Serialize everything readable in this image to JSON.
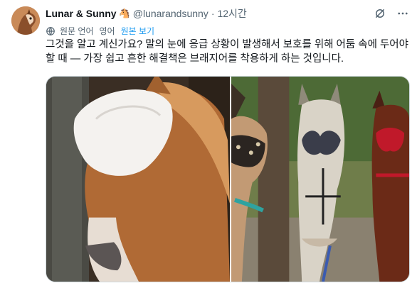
{
  "tweet": {
    "display_name": "Lunar & Sunny",
    "name_emoji": "🐴",
    "handle": "@lunarandsunny",
    "separator": "·",
    "time": "12시간",
    "translation": {
      "original_language": "원문 언어",
      "language": "영어",
      "show_original": "원본 보기"
    },
    "text": "그것을 알고 계신가요? 말의 눈에 응급 상황이 발생해서 보호를 위해 어둠 속에 두어야 할 때 — 가장 쉽고 흔한 해결책은 브래지어를 착용하게 하는 것입니다."
  },
  "icons": {
    "grok": "grok-icon",
    "more": "more-icon",
    "translate": "globe-icon"
  },
  "colors": {
    "link": "#1d9bf0",
    "secondary_text": "#536471",
    "primary_text": "#0f1419",
    "border": "#cfd9de"
  }
}
